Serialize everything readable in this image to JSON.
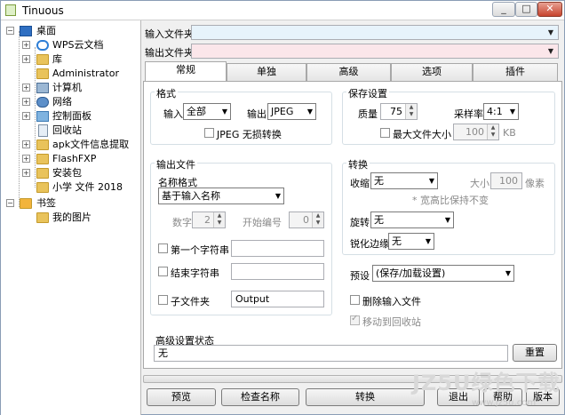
{
  "window": {
    "title": "Tinuous"
  },
  "tree": {
    "items": [
      {
        "label": "桌面",
        "icon": "desktop-icon"
      },
      {
        "label": "WPS云文档",
        "icon": "cloud-icon"
      },
      {
        "label": "库",
        "icon": "library-icon"
      },
      {
        "label": "Administrator",
        "icon": "user-folder-icon"
      },
      {
        "label": "计算机",
        "icon": "computer-icon"
      },
      {
        "label": "网络",
        "icon": "network-icon"
      },
      {
        "label": "控制面板",
        "icon": "control-panel-icon"
      },
      {
        "label": "回收站",
        "icon": "recycle-bin-icon"
      },
      {
        "label": "apk文件信息提取",
        "icon": "folder-icon"
      },
      {
        "label": "FlashFXP",
        "icon": "folder-icon"
      },
      {
        "label": "安装包",
        "icon": "folder-icon"
      },
      {
        "label": "小学 文件 2018",
        "icon": "folder-icon"
      },
      {
        "label": "书签",
        "icon": "bookmark-folder-icon"
      },
      {
        "label": "我的图片",
        "icon": "folder-icon"
      }
    ]
  },
  "paths": {
    "input_label": "输入文件夹",
    "output_label": "输出文件夹",
    "input_value": "",
    "output_value": ""
  },
  "tabs": [
    "常规",
    "单独",
    "高级",
    "选项",
    "插件"
  ],
  "format": {
    "title": "格式",
    "input_label": "输入",
    "input_value": "全部",
    "output_label": "输出",
    "output_value": "JPEG",
    "lossless_label": "JPEG 无损转换"
  },
  "save": {
    "title": "保存设置",
    "quality_label": "质量",
    "quality_value": "75",
    "sampling_label": "采样率",
    "sampling_value": "4:1",
    "maxsize_label": "最大文件大小",
    "maxsize_value": "100",
    "maxsize_unit": "KB"
  },
  "output": {
    "title": "输出文件",
    "name_format_label": "名称格式",
    "name_format_value": "基于输入名称",
    "digits_label": "数字",
    "digits_value": "2",
    "start_label": "开始编号",
    "start_value": "0",
    "first_label": "第一个字符串",
    "end_label": "结束字符串",
    "subfolder_label": "子文件夹",
    "subfolder_value": "Output"
  },
  "convert": {
    "title": "转换",
    "shrink_label": "收缩",
    "shrink_value": "无",
    "size_label": "大小",
    "size_value": "100",
    "size_unit": "像素",
    "aspect_note": "* 宽高比保持不变",
    "rotate_label": "旋转",
    "rotate_value": "无",
    "sharpen_label": "锐化边缘",
    "sharpen_value": "无"
  },
  "preset": {
    "label": "预设",
    "value": "(保存/加载设置)",
    "delete_label": "删除输入文件",
    "recycle_label": "移动到回收站"
  },
  "advanced": {
    "label": "高级设置状态",
    "value": "无",
    "reset": "重置"
  },
  "buttons": {
    "preview": "预览",
    "check": "检查名称",
    "convert": "转换",
    "exit": "退出",
    "help": "帮助",
    "version": "版本"
  },
  "watermark": {
    "text": "JZ5U绿色下载",
    "url": "www.jz5u.com"
  }
}
